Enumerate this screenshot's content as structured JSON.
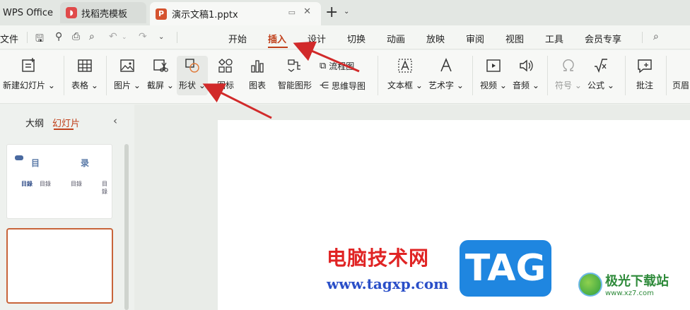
{
  "titlebar": {
    "app_tab": "WPS Office",
    "template_tab": "找稻壳模板",
    "doc_tab": "演示文稿1.pptx",
    "new_tab": "+",
    "new_tab_more": "⌄"
  },
  "menubar": {
    "file": "文件",
    "items": [
      "开始",
      "插入",
      "设计",
      "切换",
      "动画",
      "放映",
      "审阅",
      "视图",
      "工具",
      "会员专享"
    ],
    "active": "插入"
  },
  "ribbon": {
    "new_slide": "新建幻灯片",
    "table": "表格",
    "picture": "图片",
    "screenshot": "截屏",
    "shape": "形状",
    "icon": "图标",
    "chart": "图表",
    "smartart": "智能图形",
    "flowchart": "流程图",
    "mindmap": "思维导图",
    "textbox": "文本框",
    "wordart": "艺术字",
    "video": "视频",
    "audio": "音频",
    "symbol": "符号",
    "formula": "公式",
    "comment": "批注",
    "header_footer": "页眉"
  },
  "left_panel": {
    "tab_outline": "大纲",
    "tab_slides": "幻灯片",
    "thumb1": {
      "title_left": "目",
      "title_right": "录",
      "items": [
        "目錄",
        "目錄",
        "目錄",
        "目錄"
      ]
    }
  },
  "watermark": {
    "cn_text": "电脑技术网",
    "tag": "TAG",
    "url": "www.tagxp.com",
    "site2_cn": "极光下载站",
    "site2_url": "www.xz7.com"
  },
  "colors": {
    "accent": "#c0401b",
    "arrow": "#d12a2a"
  }
}
